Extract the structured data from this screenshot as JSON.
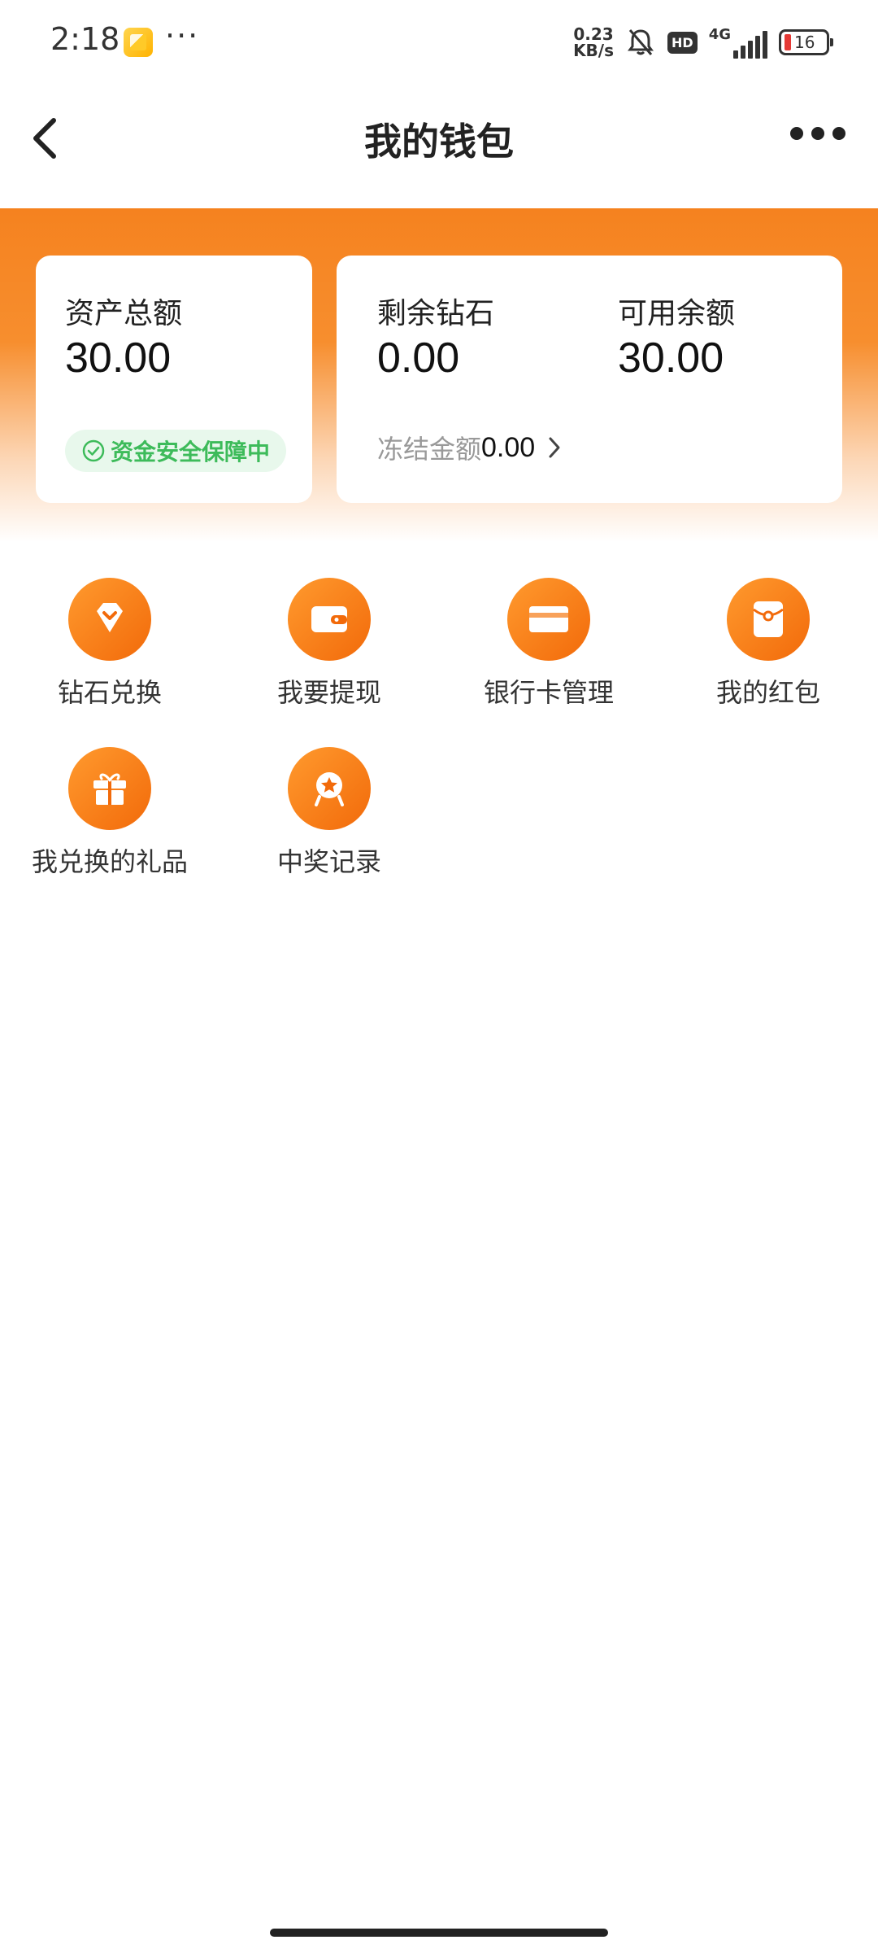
{
  "status_bar": {
    "time": "2:18",
    "more": "···",
    "speed_value": "0.23",
    "speed_unit": "KB/s",
    "hd": "HD",
    "network": "4G",
    "battery": "16"
  },
  "header": {
    "title": "我的钱包"
  },
  "wallet": {
    "total_label": "资产总额",
    "total_value": "30.00",
    "safe_badge": "资金安全保障中",
    "diamond_label": "剩余钻石",
    "diamond_value": "0.00",
    "available_label": "可用余额",
    "available_value": "30.00",
    "frozen_label": "冻结金额",
    "frozen_value": "0.00"
  },
  "menu": {
    "items": [
      {
        "label": "钻石兑换",
        "icon": "diamond-icon"
      },
      {
        "label": "我要提现",
        "icon": "wallet-icon"
      },
      {
        "label": "银行卡管理",
        "icon": "bank-card-icon"
      },
      {
        "label": "我的红包",
        "icon": "red-packet-icon"
      },
      {
        "label": "我兑换的礼品",
        "icon": "gift-icon"
      },
      {
        "label": "中奖记录",
        "icon": "award-icon"
      }
    ]
  },
  "colors": {
    "accent": "#f5821f",
    "safe_green": "#3dbb5a"
  }
}
